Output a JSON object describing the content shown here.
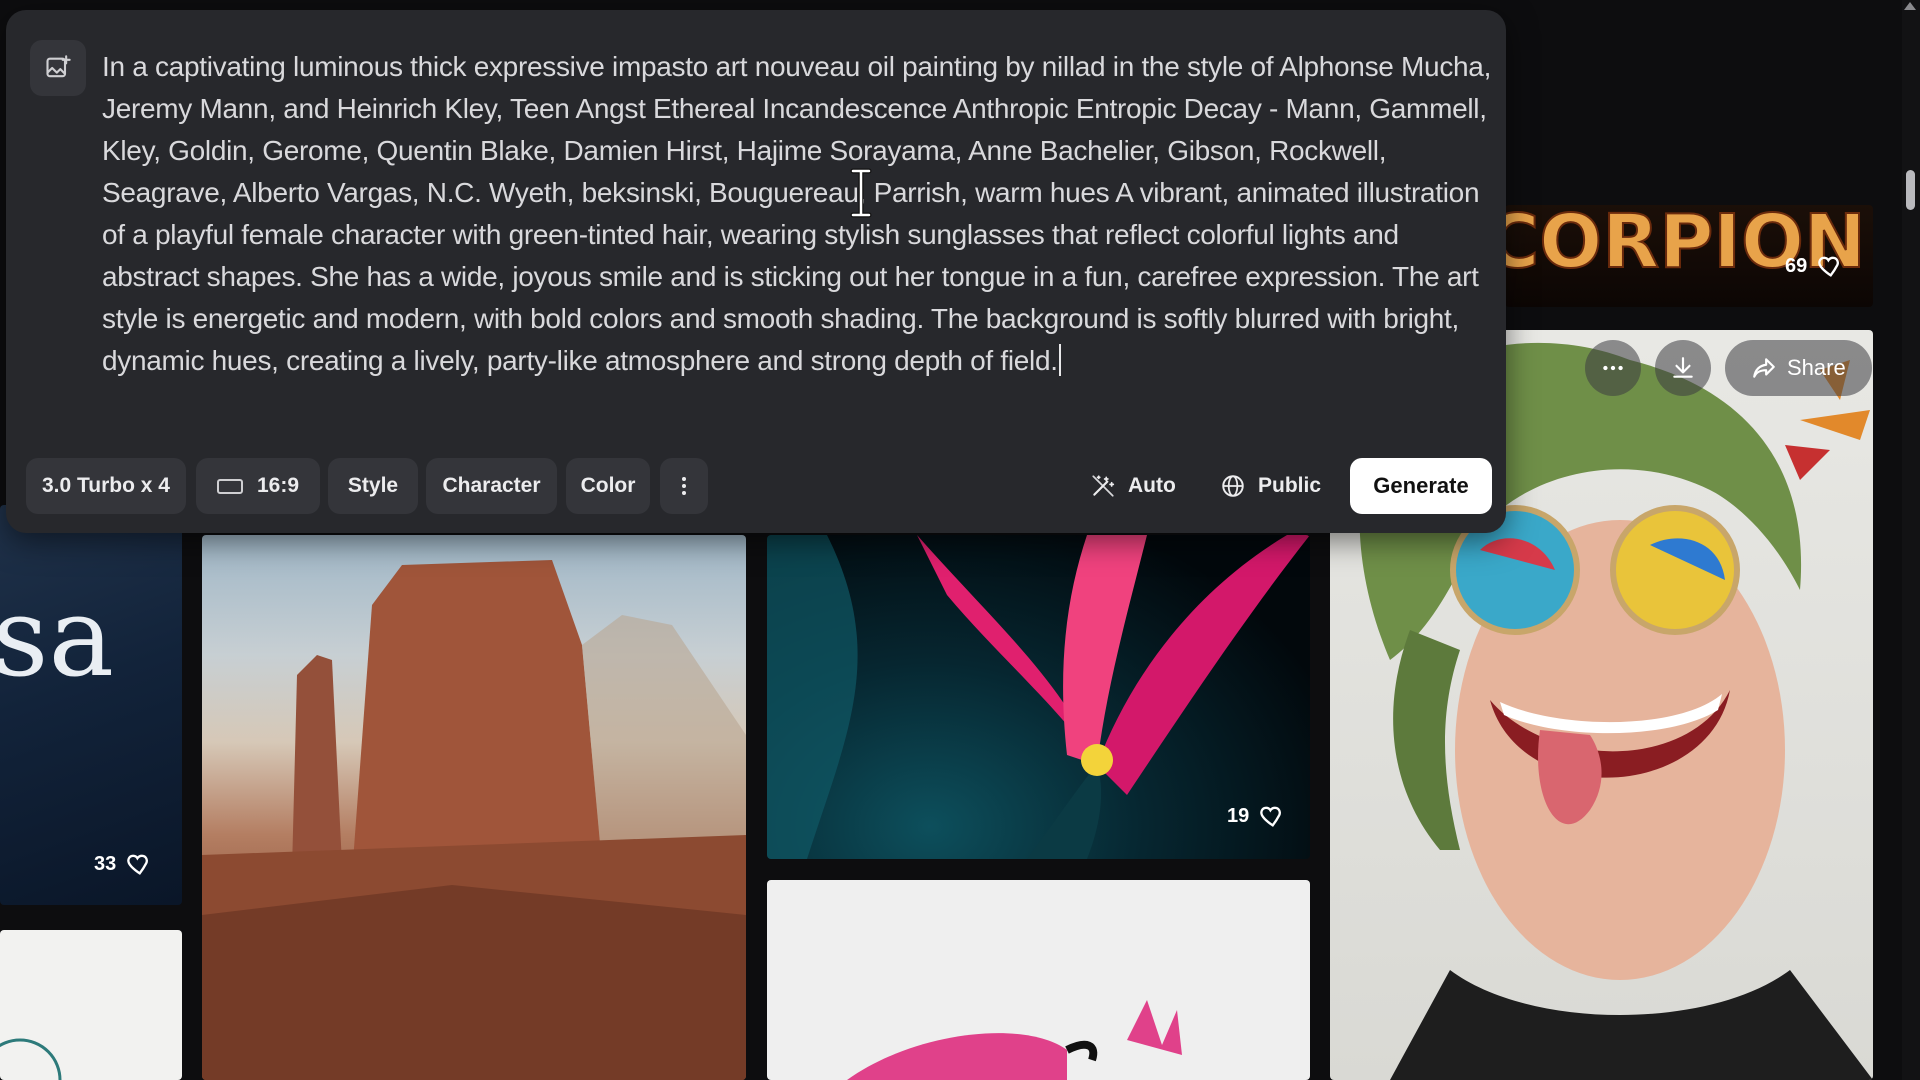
{
  "prompt": {
    "text": "In a captivating luminous thick expressive impasto art nouveau oil painting by nillad in the style of Alphonse Mucha, Jeremy Mann, and Heinrich Kley, Teen Angst Ethereal Incandescence Anthropic Entropic Decay - Mann, Gammell, Kley, Goldin, Gerome, Quentin Blake, Damien Hirst, Hajime Sorayama, Anne Bachelier, Gibson, Rockwell, Seagrave, Alberto Vargas, N.C. Wyeth, beksinski, Bouguereau, Parrish, warm hues A vibrant, animated illustration of a playful female character with green-tinted hair, wearing stylish sunglasses that reflect colorful lights and abstract shapes. She has a wide, joyous smile and is sticking out her tongue in a fun, carefree expression. The art style is energetic and modern, with bold colors and smooth shading. The background is softly blurred with bright, dynamic hues, creating a lively, party-like atmosphere and strong depth of field.",
    "image_ref_icon": "image-plus-icon"
  },
  "toolbar": {
    "model_label": "3.0 Turbo x 4",
    "ratio_label": "16:9",
    "style_label": "Style",
    "character_label": "Character",
    "color_label": "Color",
    "more_icon": "more-vertical-icon",
    "auto_label": "Auto",
    "public_label": "Public",
    "generate_label": "Generate"
  },
  "gallery": {
    "tiles": [
      {
        "name": "poster",
        "likes": "33",
        "poster_text": "sa"
      },
      {
        "name": "desert-butte"
      },
      {
        "name": "pink-lily",
        "likes": "19"
      },
      {
        "name": "white-bird"
      },
      {
        "name": "scorpion-title",
        "likes": "69"
      },
      {
        "name": "green-hair-woman",
        "actions": {
          "share_label": "Share"
        }
      }
    ]
  },
  "colors": {
    "panel": "#27282c",
    "chip": "#34353a",
    "background": "#0d0d0f",
    "generate_button": "#ffffff"
  }
}
